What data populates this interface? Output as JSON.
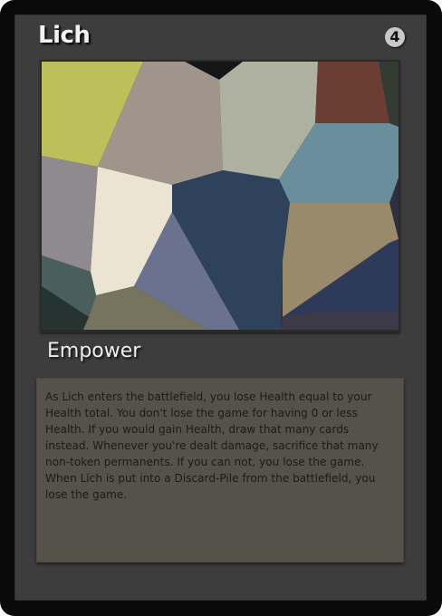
{
  "card": {
    "name": "Lich",
    "cost": "4",
    "type_line": "Empower",
    "rules_text": "As Lich enters the battlefield, you lose Health equal to your Health total. You don't lose the game for having 0 or less Health. If you would gain Health, draw that many cards instead. Whenever you're dealt damage, sacrifice that many non-token permanents. If you can not, you lose the game. When Lich is put into a Discard-Pile from the battlefield, you lose the game."
  },
  "colors": {
    "frame": "#0a0a0a",
    "body": "#3d3d3d",
    "text_box": "#555249",
    "title_text": "#f2f2f2",
    "cost_badge": "#c8c8c8"
  },
  "art": {
    "style": "voronoi-polygons",
    "palette": [
      "#bdc05a",
      "#a0958b",
      "#aeb1a0",
      "#6b3e34",
      "#6b8e9c",
      "#8f8a8d",
      "#ebe4d2",
      "#2e425b",
      "#6b7290",
      "#9a8a6c",
      "#2e3a5a",
      "#4a5e5d",
      "#76745f"
    ]
  }
}
